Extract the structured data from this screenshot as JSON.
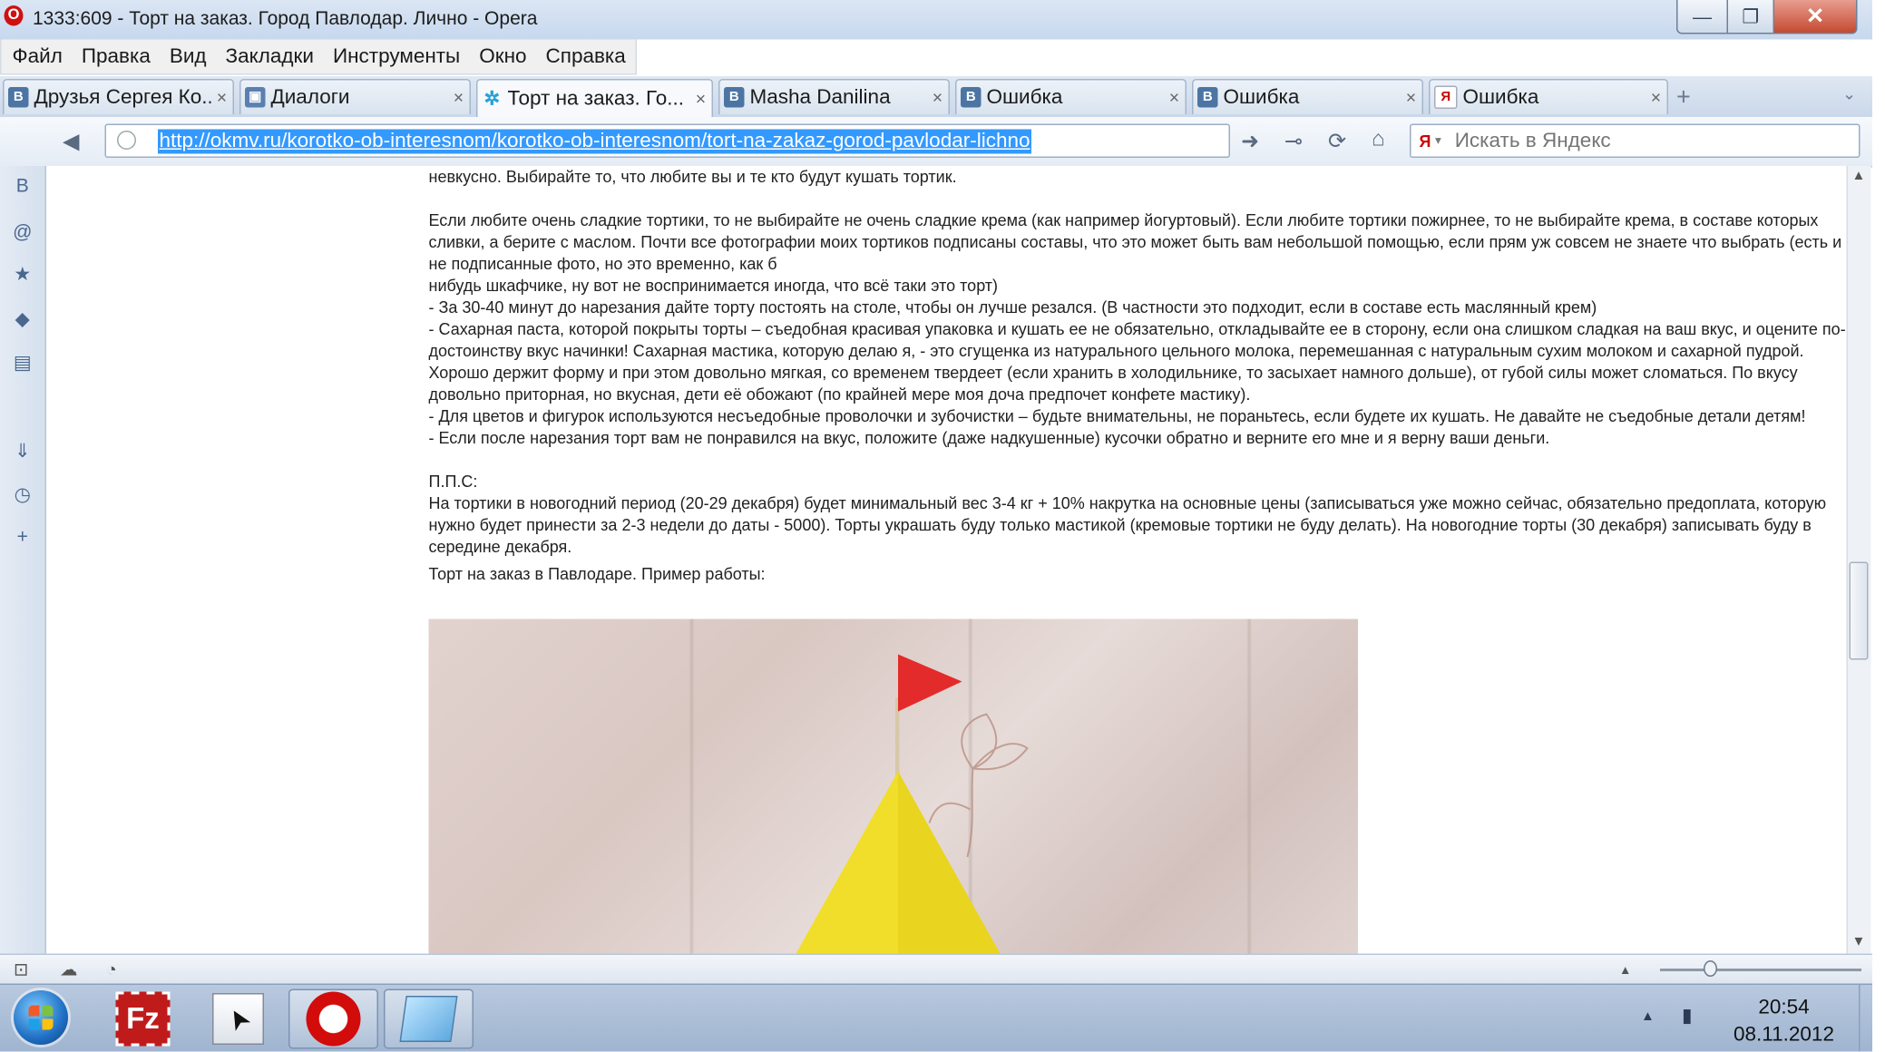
{
  "window": {
    "title": "1333:609 - Торт на заказ. Город Павлодар. Лично - Opera",
    "logo_letter": "O",
    "min_glyph": "—",
    "max_glyph": "❐",
    "close_glyph": "✕"
  },
  "menu": [
    "Файл",
    "Правка",
    "Вид",
    "Закладки",
    "Инструменты",
    "Окно",
    "Справка"
  ],
  "tabs": [
    {
      "label": "Друзья Сергея Ко...",
      "icon": "В",
      "icon_name": "vk-icon"
    },
    {
      "label": "Диалоги",
      "icon": "▣",
      "icon_name": "chat-icon"
    },
    {
      "label": "Торт на заказ. Го...",
      "icon": "✲",
      "icon_name": "site-icon"
    },
    {
      "label": "Masha Danilina",
      "icon": "В",
      "icon_name": "vk-icon"
    },
    {
      "label": "Ошибка",
      "icon": "В",
      "icon_name": "vk-icon"
    },
    {
      "label": "Ошибка",
      "icon": "В",
      "icon_name": "vk-icon"
    },
    {
      "label": "Ошибка",
      "icon": "Я",
      "icon_name": "yandex-icon"
    }
  ],
  "tab_close": "×",
  "tab_add": "+",
  "tab_list": "⌄",
  "nav": {
    "back": "◀",
    "url": "http://okmv.ru/korotko-ob-interesnom/korotko-ob-interesnom/tort-na-zakaz-gorod-pavlodar-lichno",
    "go": "➜",
    "key": "⊸",
    "reload": "⟳",
    "home": "⌂",
    "search_engine": "Я",
    "search_arrow": "▾",
    "search_placeholder": "Искать в Яндекс"
  },
  "sidebar": [
    {
      "name": "vk-panel-icon",
      "glyph": "В"
    },
    {
      "name": "mail-panel-icon",
      "glyph": "@"
    },
    {
      "name": "bookmarks-star-icon",
      "glyph": "★"
    },
    {
      "name": "widgets-icon",
      "glyph": "◆"
    },
    {
      "name": "notes-icon",
      "glyph": "▤"
    },
    {
      "name": "downloads-icon",
      "glyph": "⇓"
    },
    {
      "name": "history-clock-icon",
      "glyph": "◷"
    },
    {
      "name": "add-panel-icon",
      "glyph": "+"
    }
  ],
  "article": {
    "p0": "невкусно. Выбирайте то, что любите вы и те кто будут кушать тортик.",
    "p1": "Если любите очень сладкие тортики, то не выбирайте не очень сладкие крема (как например йогуртовый). Если любите тортики пожирнее, то не выбирайте крема, в составе которых сливки, а берите с маслом. Почти все фотографии моих тортиков подписаны составы, что это может быть вам небольшой помощью, если прям уж совсем не знаете что выбрать (есть и не подписанные фото, но это временно, как б",
    "p1b": "нибудь шкафчике, ну вот не воспринимается иногда, что всё таки это торт)",
    "p2": "- За 30-40 минут до нарезания дайте торту постоять на столе, чтобы он лучше резался. (В частности это подходит, если в составе есть маслянный крем)",
    "p3": "- Сахарная паста, которой покрыты торты – съедобная красивая упаковка и кушать ее не обязательно, откладывайте ее в сторону, если она слишком сладкая на ваш вкус, и оцените по-достоинству вкус начинки! Сахарная мастика, которую делаю я, - это сгущенка из натурального цельного молока, перемешанная с натуральным сухим молоком и сахарной пудрой. Хорошо держит форму и при этом довольно мягкая, со временем твердеет (если хранить в холодильнике, то засыхает намного дольше), от губой силы может сломаться. По вкусу довольно приторная, но вкусная, дети её обожают (по крайней мере моя доча предпочет конфете мастику).",
    "p4": "- Для цветов и фигурок используются несъедобные проволочки и зубочистки – будьте внимательны, не пораньтесь, если будете их кушать. Не давайте не съедобные детали детям!",
    "p5": "- Если после нарезания торт вам не понравился на вкус, положите (даже надкушенные) кусочки обратно и верните его мне и я верну ваши деньги.",
    "pps_title": "П.П.С:",
    "pps_text": "На тортики в новогодний период (20-29 декабря) будет минимальный вес 3-4 кг + 10% накрутка на основные цены (записываться уже можно сейчас, обязательно предоплата, которую нужно будет принести за 2-3 недели до даты - 5000). Торты украшать буду только мастикой (кремовые тортики не буду делать). На новогодние торты (30 декабря) записывать буду в середине декабря.",
    "example": "Торт на заказ в Павлодаре. Пример работы:"
  },
  "scroll": {
    "up": "▲",
    "down": "▼",
    "position": 0.58
  },
  "status": {
    "panel": "⊡",
    "cloud": "☁",
    "speed": "◔",
    "zoom_arrow": "▲",
    "zoom_level": 0.25
  },
  "taskbar": {
    "filezilla_letter": "Fz",
    "cursor_glyph": "➤",
    "tray_arrow": "▲",
    "network": "▮",
    "time": "20:54",
    "date": "08.11.2012"
  },
  "colors": {
    "selection": "#3399ff",
    "cake": "#f1de2a",
    "flag": "#e32b2b"
  }
}
